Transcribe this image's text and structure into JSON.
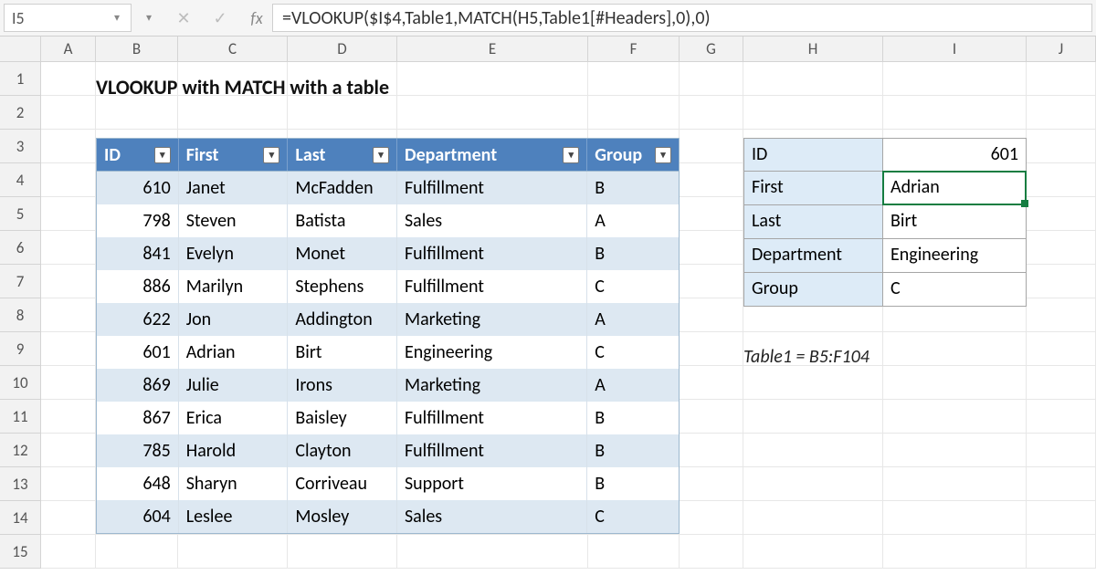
{
  "namebox": {
    "value": "I5"
  },
  "formula": "=VLOOKUP($I$4,Table1,MATCH(H5,Table1[#Headers],0),0)",
  "columns": [
    "A",
    "B",
    "C",
    "D",
    "E",
    "F",
    "G",
    "H",
    "I",
    "J"
  ],
  "col_widths": [
    "cA",
    "cB",
    "cC",
    "cD",
    "cE",
    "cF",
    "cG",
    "cH",
    "cI",
    "cJ"
  ],
  "row_numbers": [
    1,
    2,
    3,
    4,
    5,
    6,
    7,
    8,
    9,
    10,
    11,
    12,
    13,
    14,
    15
  ],
  "title": "VLOOKUP with MATCH with a table",
  "table1": {
    "headers": [
      "ID",
      "First",
      "Last",
      "Department",
      "Group"
    ],
    "rows": [
      [
        610,
        "Janet",
        "McFadden",
        "Fulfillment",
        "B"
      ],
      [
        798,
        "Steven",
        "Batista",
        "Sales",
        "A"
      ],
      [
        841,
        "Evelyn",
        "Monet",
        "Fulfillment",
        "B"
      ],
      [
        886,
        "Marilyn",
        "Stephens",
        "Fulfillment",
        "C"
      ],
      [
        622,
        "Jon",
        "Addington",
        "Marketing",
        "A"
      ],
      [
        601,
        "Adrian",
        "Birt",
        "Engineering",
        "C"
      ],
      [
        869,
        "Julie",
        "Irons",
        "Marketing",
        "A"
      ],
      [
        867,
        "Erica",
        "Baisley",
        "Fulfillment",
        "B"
      ],
      [
        785,
        "Harold",
        "Clayton",
        "Fulfillment",
        "B"
      ],
      [
        648,
        "Sharyn",
        "Corriveau",
        "Support",
        "B"
      ],
      [
        604,
        "Leslee",
        "Mosley",
        "Sales",
        "C"
      ]
    ]
  },
  "lookup": {
    "rows": [
      {
        "key": "ID",
        "value": "601",
        "rightAlign": true
      },
      {
        "key": "First",
        "value": "Adrian"
      },
      {
        "key": "Last",
        "value": "Birt"
      },
      {
        "key": "Department",
        "value": "Engineering"
      },
      {
        "key": "Group",
        "value": "C"
      }
    ]
  },
  "note": "Table1 = B5:F104",
  "chart_data": {
    "type": "table",
    "title": "VLOOKUP with MATCH with a table",
    "columns": [
      "ID",
      "First",
      "Last",
      "Department",
      "Group"
    ],
    "rows": [
      [
        610,
        "Janet",
        "McFadden",
        "Fulfillment",
        "B"
      ],
      [
        798,
        "Steven",
        "Batista",
        "Sales",
        "A"
      ],
      [
        841,
        "Evelyn",
        "Monet",
        "Fulfillment",
        "B"
      ],
      [
        886,
        "Marilyn",
        "Stephens",
        "Fulfillment",
        "C"
      ],
      [
        622,
        "Jon",
        "Addington",
        "Marketing",
        "A"
      ],
      [
        601,
        "Adrian",
        "Birt",
        "Engineering",
        "C"
      ],
      [
        869,
        "Julie",
        "Irons",
        "Marketing",
        "A"
      ],
      [
        867,
        "Erica",
        "Baisley",
        "Fulfillment",
        "B"
      ],
      [
        785,
        "Harold",
        "Clayton",
        "Fulfillment",
        "B"
      ],
      [
        648,
        "Sharyn",
        "Corriveau",
        "Support",
        "B"
      ],
      [
        604,
        "Leslee",
        "Mosley",
        "Sales",
        "C"
      ]
    ],
    "lookup_input": 601,
    "lookup_output": {
      "First": "Adrian",
      "Last": "Birt",
      "Department": "Engineering",
      "Group": "C"
    }
  }
}
